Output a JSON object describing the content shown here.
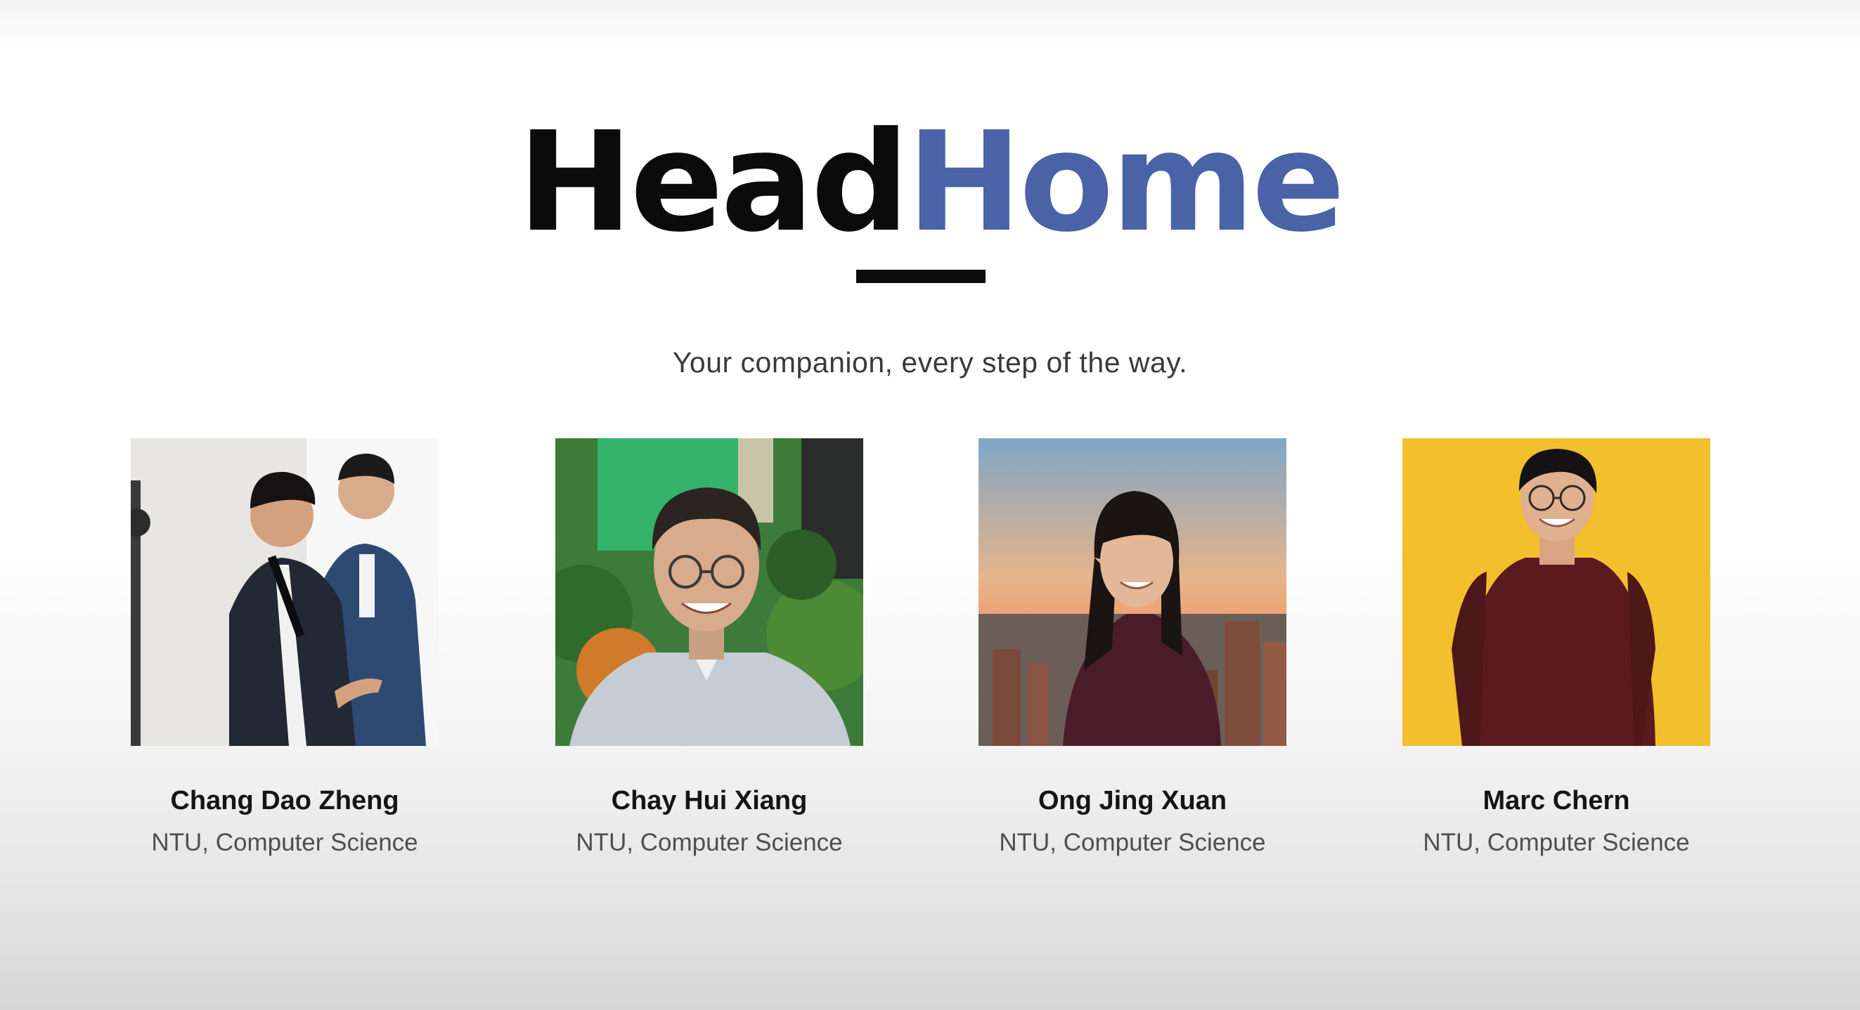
{
  "title": {
    "part_a": "Head",
    "part_b": "Home",
    "color_a": "#0b0b0b",
    "color_b": "#4a62a6"
  },
  "tagline": "Your companion, every step of the way.",
  "team": [
    {
      "name": "Chang Dao Zheng",
      "affiliation": "NTU, Computer Science",
      "photo_icon": "person-presenting-photo",
      "photo_bg": "#eeeeee"
    },
    {
      "name": "Chay Hui Xiang",
      "affiliation": "NTU, Computer Science",
      "photo_icon": "person-greenery-photo",
      "photo_bg": "#3f8a3a"
    },
    {
      "name": "Ong Jing Xuan",
      "affiliation": "NTU, Computer Science",
      "photo_icon": "person-city-sunset-photo",
      "photo_bg": "#c9a98a"
    },
    {
      "name": "Marc Chern",
      "affiliation": "NTU, Computer Science",
      "photo_icon": "person-yellow-backdrop-photo",
      "photo_bg": "#f2c02e"
    }
  ]
}
